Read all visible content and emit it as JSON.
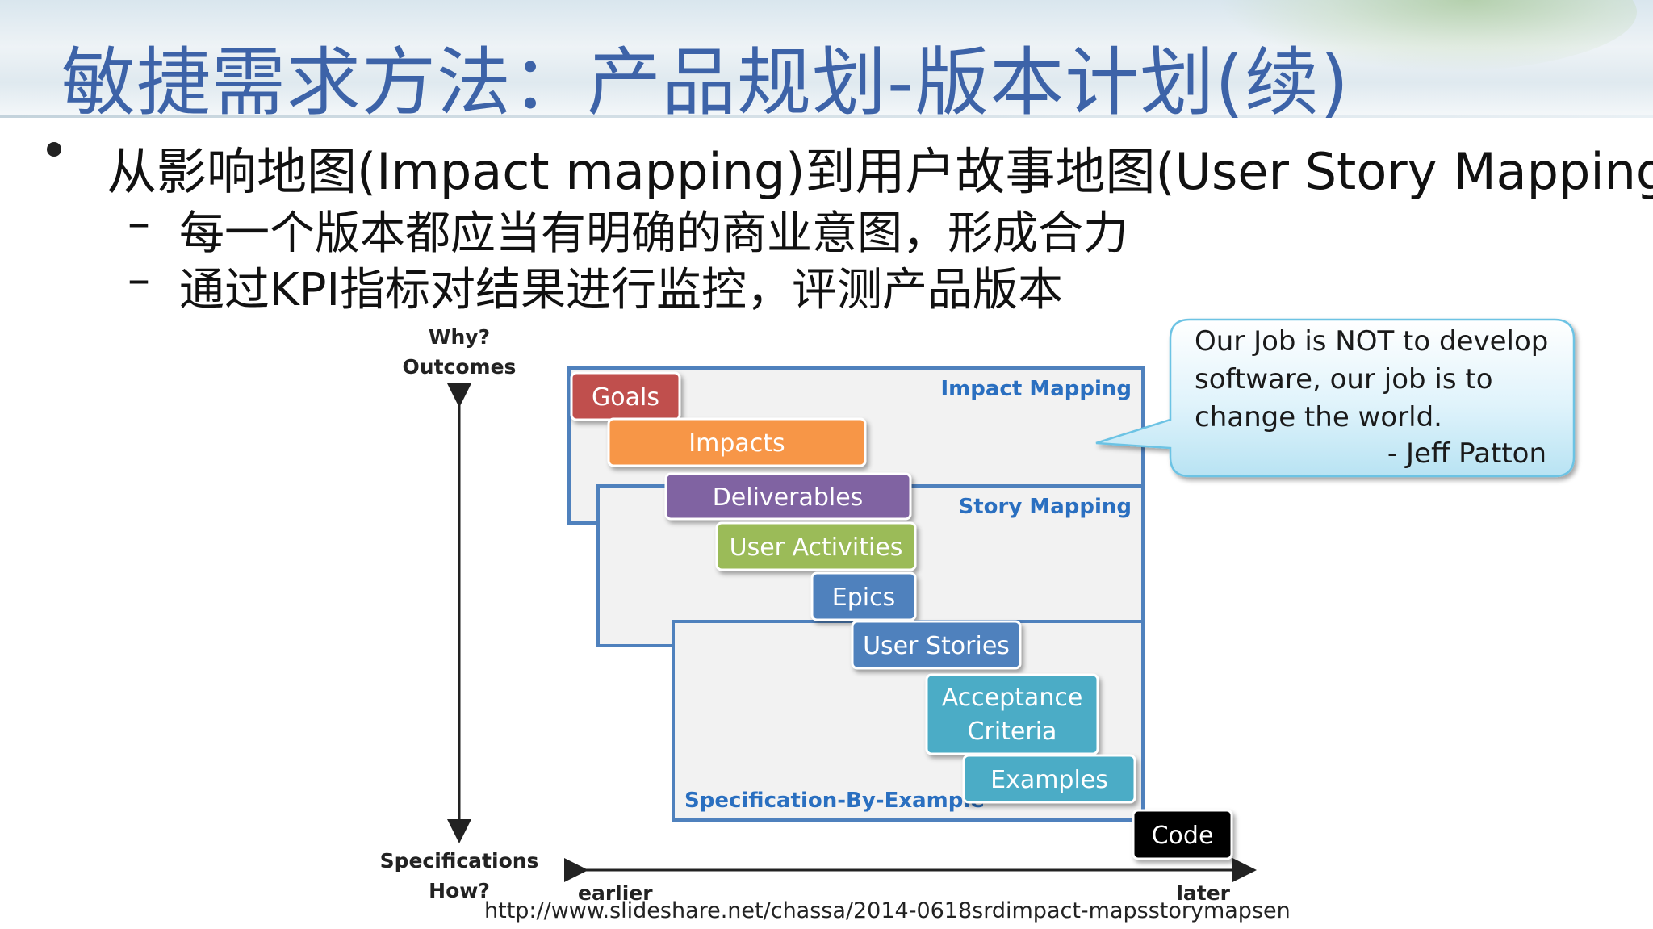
{
  "slide": {
    "title": "敏捷需求方法：产品规划-版本计划(续)",
    "bullet": "从影响地图(Impact mapping)到用户故事地图(User Story Mapping)",
    "sub_bullets": [
      "每一个版本都应当有明确的商业意图，形成合力",
      "通过KPI指标对结果进行监控，评测产品版本"
    ],
    "dash": "–"
  },
  "diagram": {
    "y_axis_top": [
      "Why?",
      "Outcomes"
    ],
    "y_axis_bottom": [
      "Specifications",
      "How?"
    ],
    "x_axis_left": "earlier",
    "x_axis_right": "later",
    "regions": {
      "impact": "Impact Mapping",
      "story": "Story Mapping",
      "spec": "Specification-By-Example"
    },
    "boxes": {
      "goals": "Goals",
      "impacts": "Impacts",
      "deliverables": "Deliverables",
      "user_activities": "User Activities",
      "epics": "Epics",
      "user_stories": "User Stories",
      "acceptance_1": "Acceptance",
      "acceptance_2": "Criteria",
      "examples": "Examples",
      "code": "Code"
    },
    "colors": {
      "goals": "#c0504d",
      "impacts": "#f79646",
      "deliverables": "#8064a2",
      "user_activities": "#9bbb59",
      "epics": "#4f81bd",
      "user_stories": "#4f81bd",
      "acceptance": "#4bacc6",
      "examples": "#4bacc6",
      "code": "#000000",
      "region_border": "#4f81bd"
    }
  },
  "callout": {
    "quote": "Our Job is NOT to develop software, our job is to change the world.",
    "author": "- Jeff Patton"
  },
  "source": "http://www.slideshare.net/chassa/2014-0618srdimpact-mapsstorymapsen"
}
